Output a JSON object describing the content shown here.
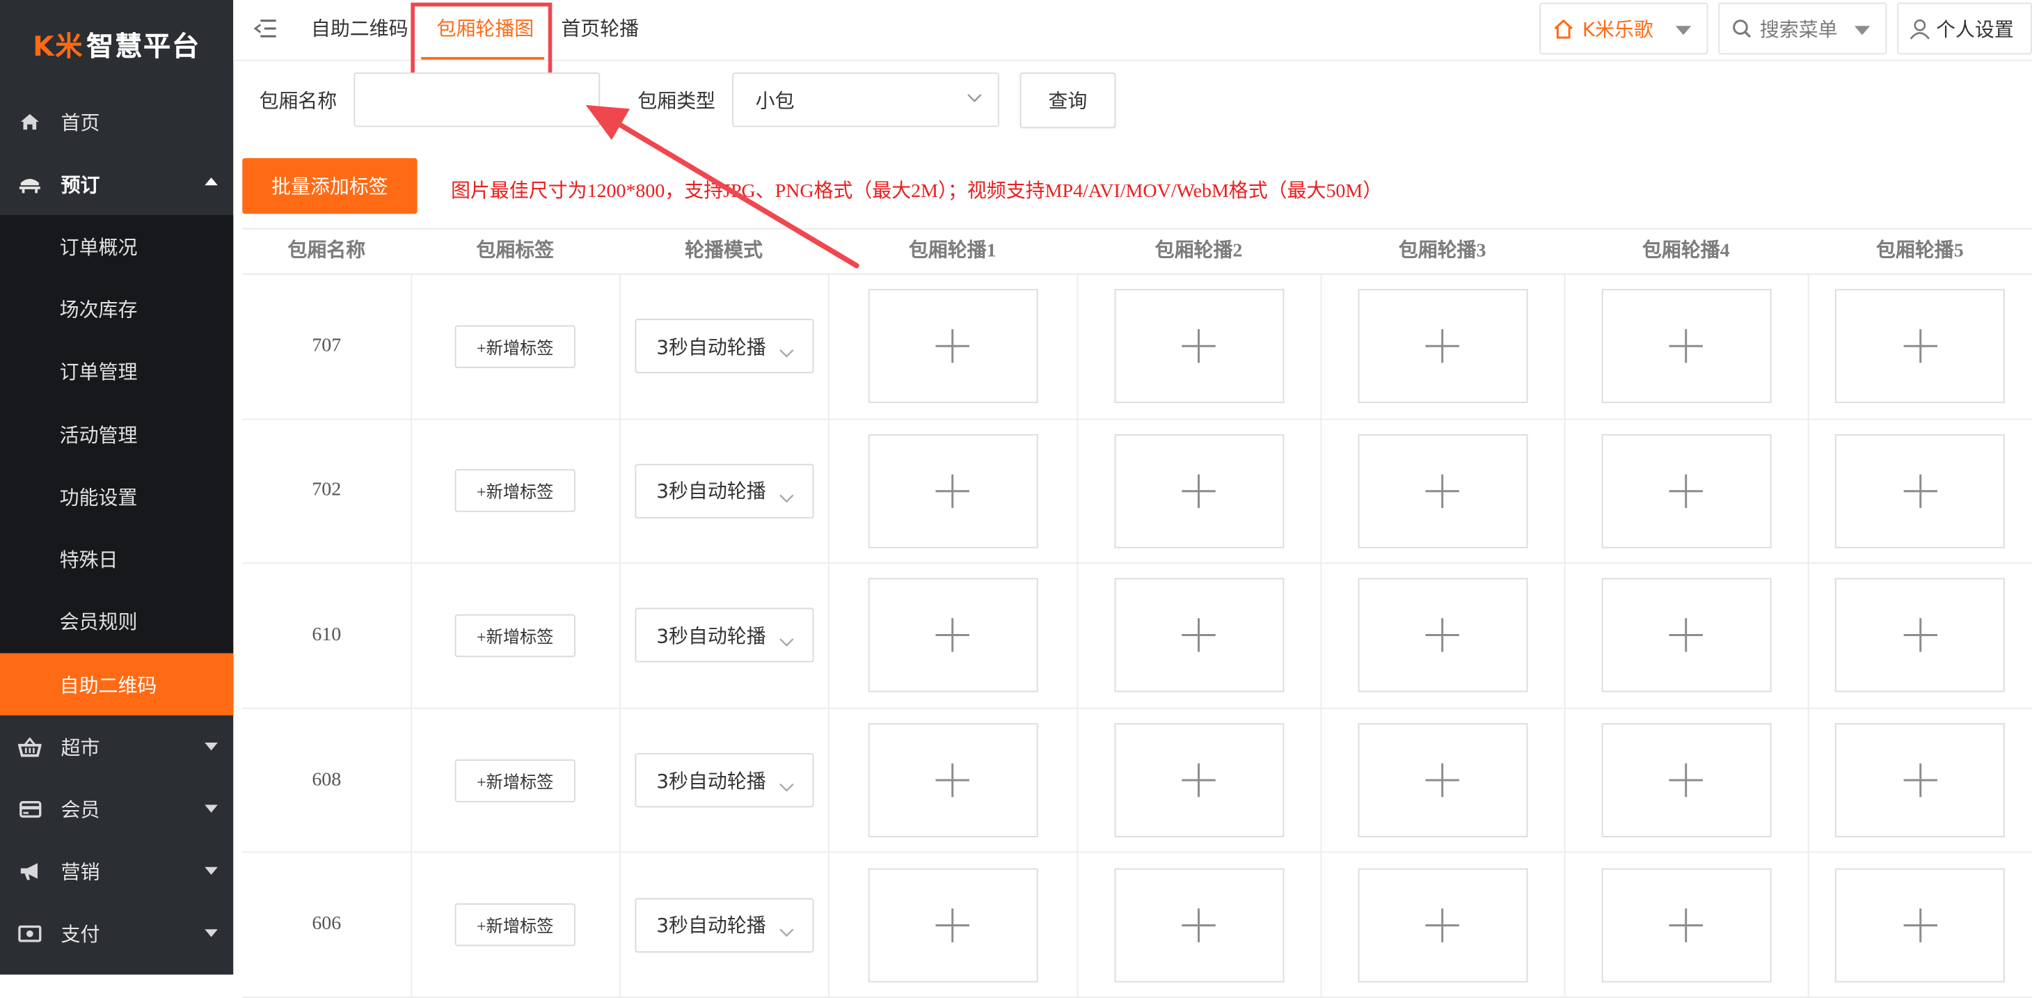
{
  "brand": {
    "logo_km": "K米",
    "logo_text": "智慧平台"
  },
  "sidebar": {
    "items": [
      {
        "label": "首页",
        "icon": "home-icon"
      },
      {
        "label": "预订",
        "icon": "reservation-icon",
        "open": true
      },
      {
        "label": "超市",
        "icon": "basket-icon"
      },
      {
        "label": "会员",
        "icon": "card-icon"
      },
      {
        "label": "营销",
        "icon": "megaphone-icon"
      },
      {
        "label": "支付",
        "icon": "money-icon"
      }
    ],
    "submenu": [
      "订单概况",
      "场次库存",
      "订单管理",
      "活动管理",
      "功能设置",
      "特殊日",
      "会员规则",
      "自助二维码"
    ],
    "active_sub": "自助二维码"
  },
  "header": {
    "tabs": [
      "自助二维码",
      "包厢轮播图",
      "首页轮播"
    ],
    "active_tab": "包厢轮播图",
    "store": "K米乐歌",
    "search_menu": "搜索菜单",
    "user_settings": "个人设置"
  },
  "filter": {
    "name_label": "包厢名称",
    "name_value": "",
    "type_label": "包厢类型",
    "type_value": "小包",
    "query_button": "查询"
  },
  "batch_button": "批量添加标签",
  "notice": "图片最佳尺寸为1200*800，支持JPG、PNG格式（最大2M）；视频支持MP4/AVI/MOV/WebM格式（最大50M）",
  "table": {
    "headers": [
      "包厢名称",
      "包厢标签",
      "轮播模式",
      "包厢轮播1",
      "包厢轮播2",
      "包厢轮播3",
      "包厢轮播4",
      "包厢轮播5"
    ],
    "add_tag_label": "+新增标签",
    "mode_label": "3秒自动轮播",
    "rows": [
      {
        "name": "707"
      },
      {
        "name": "702"
      },
      {
        "name": "610"
      },
      {
        "name": "608"
      },
      {
        "name": "606"
      }
    ]
  },
  "colors": {
    "accent": "#ff6a14",
    "sidebar_bg": "#2b2e33",
    "submenu_bg": "#16181b",
    "annotation_red": "#f0464e",
    "notice_red": "#ea1d1d"
  }
}
